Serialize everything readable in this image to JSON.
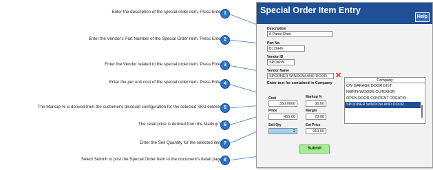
{
  "callouts": [
    {
      "n": "1",
      "text": "Enter the description of the special order item. Press Enter."
    },
    {
      "n": "2",
      "text": "Enter the Vendor's Part Number of the Special Order Item. Press Enter."
    },
    {
      "n": "3",
      "text": "Enter the Vendor related to the special order item. Press Enter."
    },
    {
      "n": "4",
      "text": "Enter the per unit cost of the special order item. Press Enter."
    },
    {
      "n": "5",
      "text": "The Markup % is derived from the customer's discount configuration for the selected SKU entered."
    },
    {
      "n": "6",
      "text": "The retail price is derived from the Markup %"
    },
    {
      "n": "7",
      "text": "Enter the Sell Quantity for the selected item."
    },
    {
      "n": "8",
      "text": "Select Submit to post the Special Order Item to the document's detail page."
    }
  ],
  "window": {
    "title": "Special Order Item Entry",
    "help_label": "Help",
    "description_label": "Description",
    "description_value": "6 Panel Door",
    "part_label": "Part No.",
    "part_value": "B126H6",
    "vendor_id_label": "Vendor ID",
    "vendor_id_value": "SPOWIN",
    "vendor_name_label": "Vendor Name",
    "vendor_name_value": "SPOONER WINDOW AND DOOR",
    "note": "Enter text for contained in Company",
    "cost_label": "Cost",
    "cost_value": "350.0000",
    "markup_label": "Markup %",
    "markup_value": "30.00",
    "price_label": "Price",
    "price_value": "455.00",
    "margin_label": "Margin",
    "margin_value": "23.08",
    "sell_qty_label": "Sell Qty",
    "sell_qty_value": "2",
    "ext_price_label": "Ext Price",
    "ext_price_value": "910.00",
    "submit_label": "Submit",
    "company_header": "Company",
    "companies": [
      {
        "name": "CW GARAGE DOOR DIST."
      },
      {
        "name": "NORTHWOODS OUTDOOR"
      },
      {
        "name": "OPEN DOOR CONTENT CREATIO"
      },
      {
        "name": "SPOONER WINDOW AND DOOR"
      }
    ],
    "selected_company": "SPOONER WINDOW AND DOOR"
  },
  "colors": {
    "titlebar": "#1f4f96",
    "badge": "#2a73c9",
    "submit": "#a4ef8f",
    "qty_field": "#9fd3f0",
    "delete_x": "#d62020"
  }
}
